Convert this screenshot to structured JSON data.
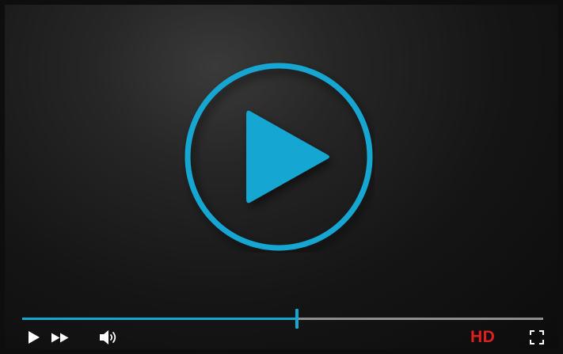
{
  "player": {
    "accent_color": "#16a6d2",
    "hd_color": "#e01f1f",
    "progress_fraction": 0.528,
    "hd_label": "HD",
    "icons": {
      "center": "big-play-icon",
      "play": "play-icon",
      "forward": "fast-forward-icon",
      "volume": "volume-icon",
      "fullscreen": "fullscreen-icon"
    }
  }
}
